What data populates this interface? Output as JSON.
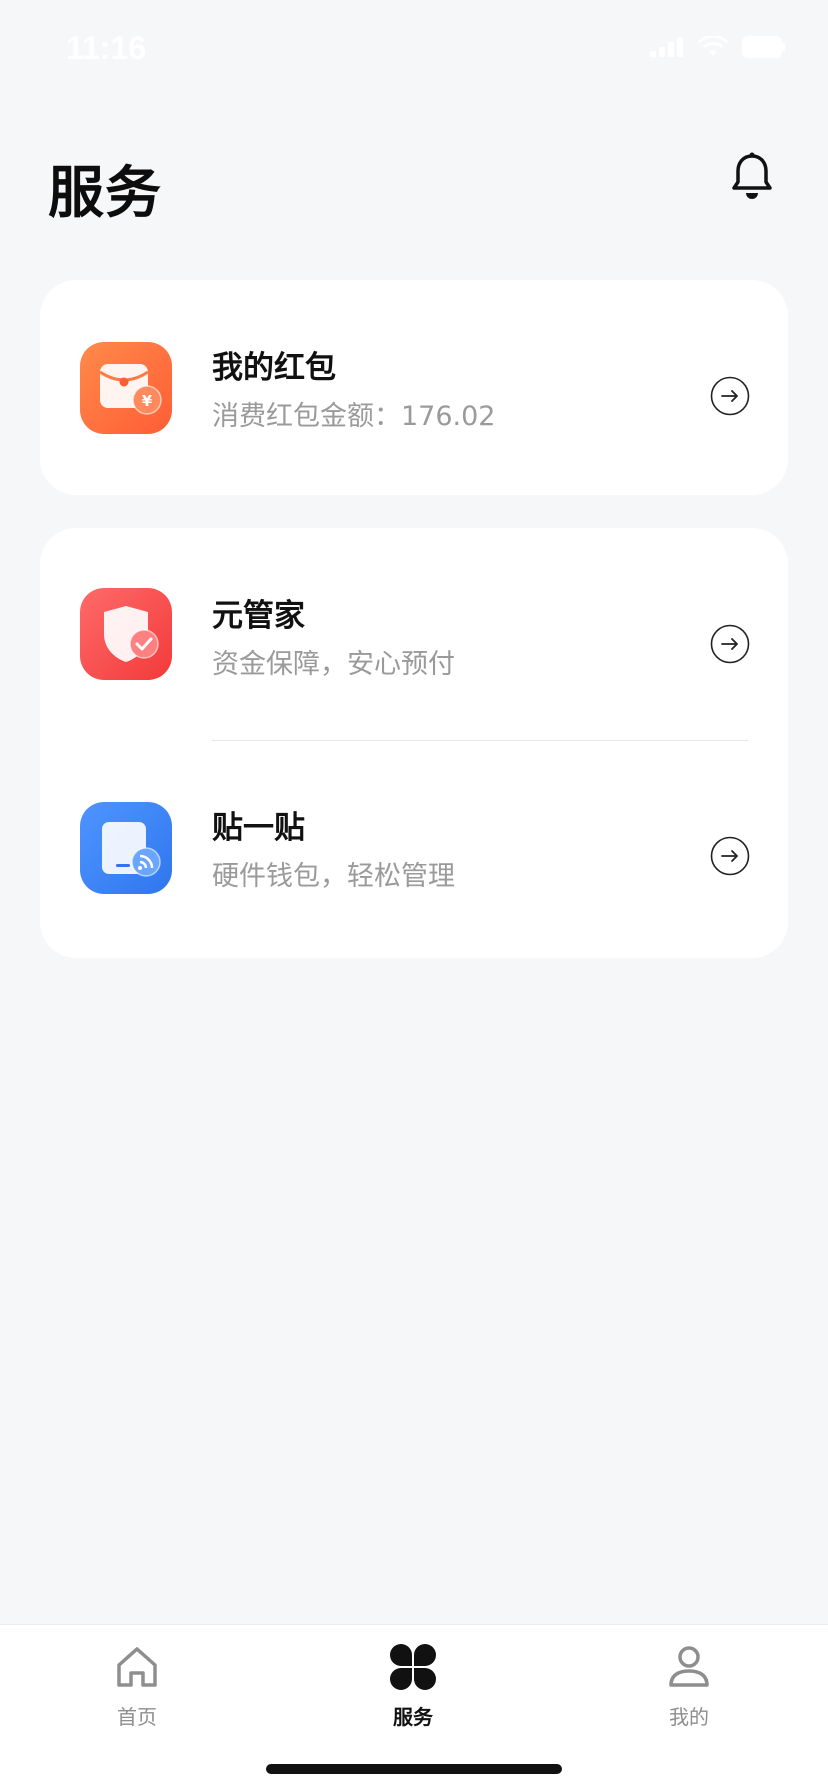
{
  "status_bar": {
    "time": "11:16"
  },
  "header": {
    "title": "服务"
  },
  "services": {
    "red_packet": {
      "title": "我的红包",
      "subtitle": "消费红包金额：176.02"
    },
    "yuan_guanjia": {
      "title": "元管家",
      "subtitle": "资金保障，安心预付"
    },
    "tie_yi_tie": {
      "title": "贴一贴",
      "subtitle": "硬件钱包，轻松管理"
    }
  },
  "tabbar": {
    "items": [
      {
        "label": "首页",
        "icon": "home-icon",
        "active": false
      },
      {
        "label": "服务",
        "icon": "grid-clover-icon",
        "active": true
      },
      {
        "label": "我的",
        "icon": "user-icon",
        "active": false
      }
    ]
  },
  "colors": {
    "background": "#f6f7f9",
    "card": "#ffffff",
    "red_packet_icon": "#ff6b3d",
    "shield_icon": "#ff4a4a",
    "nfc_icon": "#3d86f5",
    "secondary_text": "#9a9a9a"
  }
}
